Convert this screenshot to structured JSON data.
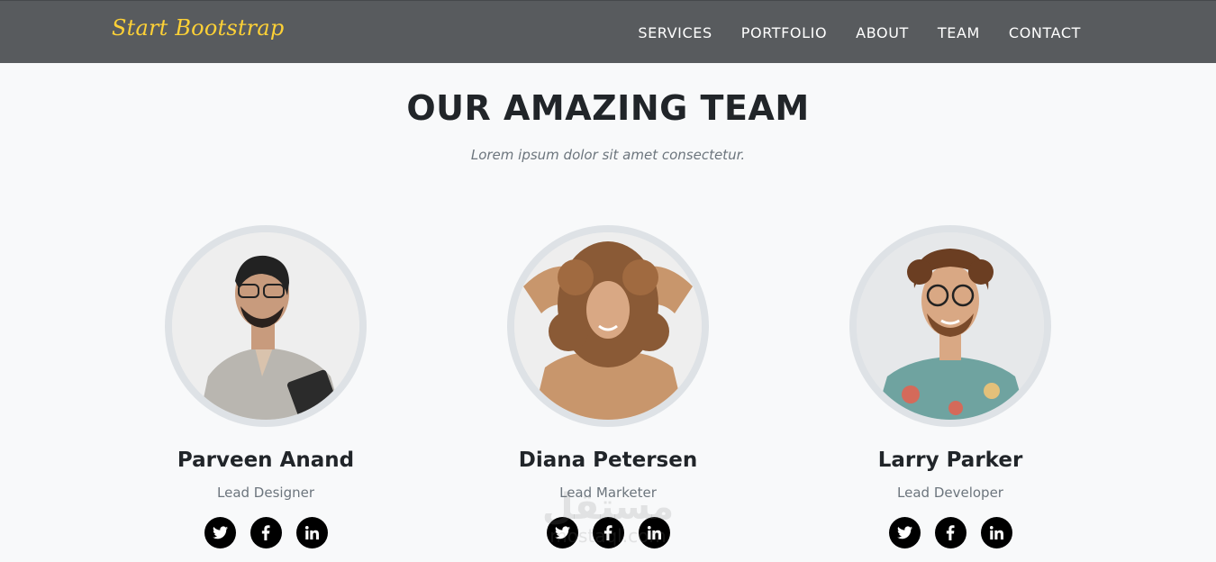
{
  "navbar": {
    "brand": "Start Bootstrap",
    "links": [
      {
        "label": "SERVICES"
      },
      {
        "label": "PORTFOLIO"
      },
      {
        "label": "ABOUT"
      },
      {
        "label": "TEAM"
      },
      {
        "label": "CONTACT"
      }
    ],
    "brand_color": "#fed136",
    "background_color": "#585b5e"
  },
  "team_section": {
    "heading": "OUR AMAZING TEAM",
    "subheading": "Lorem ipsum dolor sit amet consectetur.",
    "members": [
      {
        "name": "Parveen Anand",
        "role": "Lead Designer",
        "socials": [
          "twitter-icon",
          "facebook-icon",
          "linkedin-icon"
        ]
      },
      {
        "name": "Diana Petersen",
        "role": "Lead Marketer",
        "socials": [
          "twitter-icon",
          "facebook-icon",
          "linkedin-icon"
        ]
      },
      {
        "name": "Larry Parker",
        "role": "Lead Developer",
        "socials": [
          "twitter-icon",
          "facebook-icon",
          "linkedin-icon"
        ]
      }
    ]
  },
  "watermark": {
    "arabic": "مستقل",
    "latin": "mostaql.com"
  }
}
